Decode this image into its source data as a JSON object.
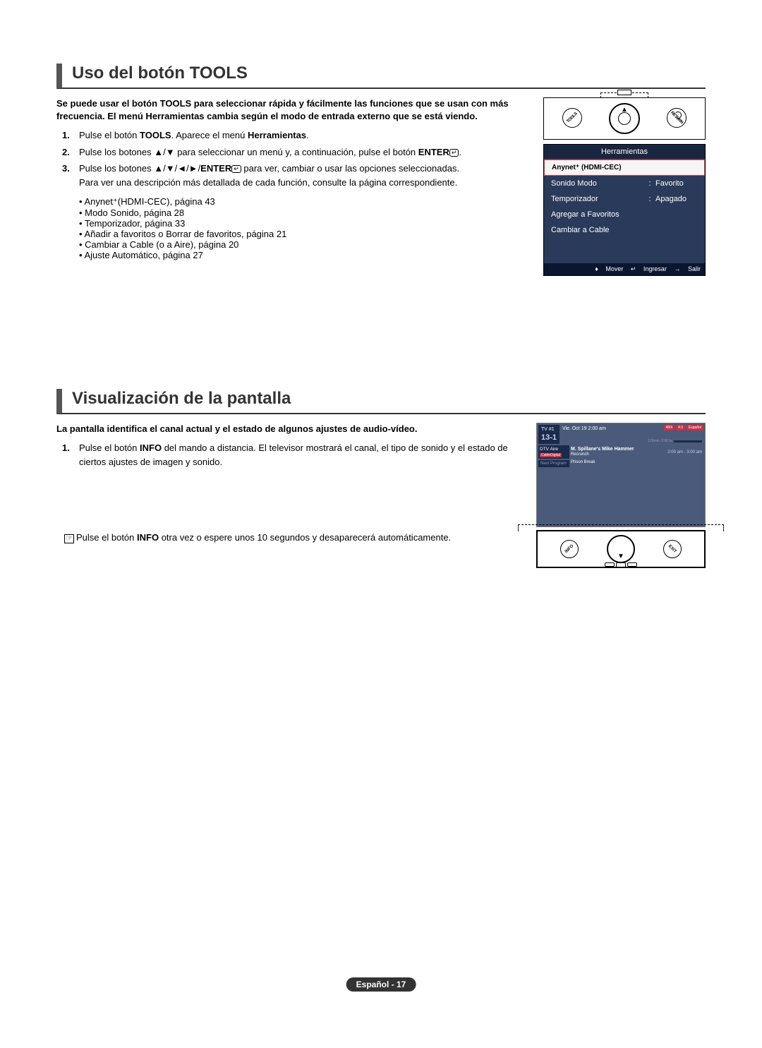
{
  "page_footer": "Español - 17",
  "section1": {
    "title": "Uso del botón TOOLS",
    "intro": "Se puede usar el botón TOOLS para seleccionar rápida y fácilmente las funciones que se usan con más frecuencia. El menú Herramientas cambia según el modo de entrada externo que se está viendo.",
    "step1_a": "Pulse el botón ",
    "step1_b": "TOOLS",
    "step1_c": ". Aparece el menú ",
    "step1_d": "Herramientas",
    "step1_e": ".",
    "step2_a": "Pulse los botones ▲/▼ para seleccionar un menú y, a continuación, pulse el botón ",
    "step2_b": "ENTER",
    "step2_c": ".",
    "step3_a": "Pulse los botones ▲/▼/◄/►/",
    "step3_b": "ENTER",
    "step3_c": " para ver, cambiar o usar las opciones seleccionadas.",
    "step3_d": "Para ver una descripción más detallada de cada función, consulte la página correspondiente.",
    "bullets": {
      "b1": "Anynet⁺(HDMI-CEC), página 43",
      "b2": "Modo Sonido, página 28",
      "b3": "Temporizador, página 33",
      "b4": "Añadir a favoritos o Borrar de favoritos, página 21",
      "b5": "Cambiar a Cable (o a Aire), página 20",
      "b6": "Ajuste Automático, página 27"
    },
    "remote": {
      "tools_label": "TOOLS",
      "return_label": "RETURN"
    },
    "menu": {
      "header": "Herramientas",
      "item_selected": "Anynet⁺ (HDMI-CEC)",
      "items": [
        {
          "label": "Sonido Modo",
          "value": "Favorito"
        },
        {
          "label": "Temporizador",
          "value": "Apagado"
        },
        {
          "label": "Agregar a Favoritos",
          "value": ""
        },
        {
          "label": "Cambiar a Cable",
          "value": ""
        }
      ],
      "footer": {
        "mover": "Mover",
        "ingresar": "Ingresar",
        "salir": "Salir"
      }
    }
  },
  "section2": {
    "title": "Visualización de la pantalla",
    "intro": "La pantalla identifica el canal actual y el estado de algunos ajustes de audio-vídeo.",
    "step1_a": "Pulse el botón ",
    "step1_b": "INFO",
    "step1_c": " del mando a distancia. El televisor mostrará el canal, el tipo de sonido y el estado de ciertos ajustes de imagen y sonido.",
    "note_a": "Pulse el botón ",
    "note_b": "INFO",
    "note_c": "  otra vez o espere unos 10 segundos y desaparecerá automáticamente.",
    "remote": {
      "info_label": "INFO",
      "exit_label": "EXIT"
    },
    "info_screen": {
      "tv_label": "TV #1",
      "channel": "13-1",
      "datetime": "Vie. Oct 19  2:00 am",
      "dtv": "DTV Aire",
      "cable_badge": "CableDigital",
      "program": "M. Spillane's Mike Hammer",
      "desc": "Recrunch",
      "next_label": "Next Program",
      "next_program": "Prison Break",
      "time_elapsed": "120min: 2:00 hr",
      "time_range": "2:00 am - 3:00 am",
      "badges": {
        "b1": "480i",
        "b2": "4:3",
        "b3": "Español"
      }
    }
  }
}
